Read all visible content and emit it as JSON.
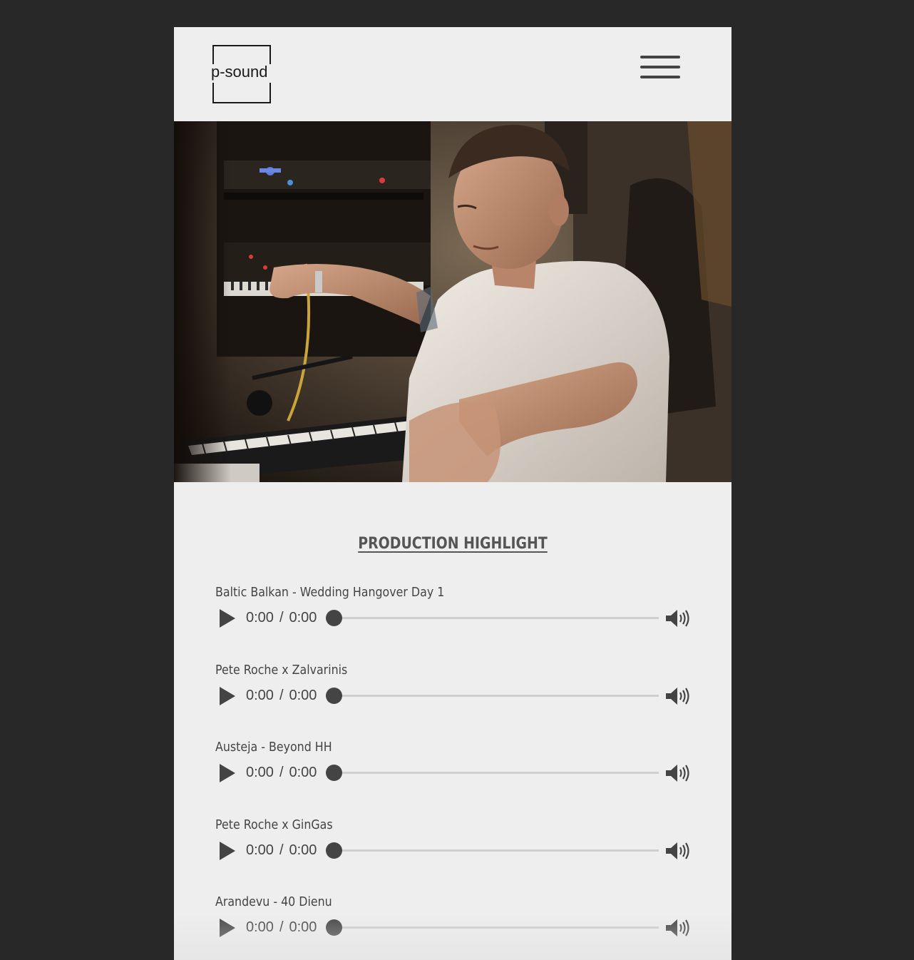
{
  "header": {
    "logo_text": "p-sound"
  },
  "hero": {
    "image": "studio-producer-photo"
  },
  "section": {
    "title": "PRODUCTION HIGHLIGHT"
  },
  "tracks": [
    {
      "title": "Baltic Balkan - Wedding Hangover Day 1",
      "current": "0:00",
      "separator": "/",
      "duration": "0:00",
      "progress": 0
    },
    {
      "title": "Pete Roche x Zalvarinis",
      "current": "0:00",
      "separator": "/",
      "duration": "0:00",
      "progress": 0
    },
    {
      "title": "Austeja - Beyond HH",
      "current": "0:00",
      "separator": "/",
      "duration": "0:00",
      "progress": 0
    },
    {
      "title": "Pete Roche x GinGas",
      "current": "0:00",
      "separator": "/",
      "duration": "0:00",
      "progress": 0
    },
    {
      "title": "Arandevu - 40 Dienu",
      "current": "0:00",
      "separator": "/",
      "duration": "0:00",
      "progress": 0
    }
  ],
  "icons": {
    "menu": "hamburger-menu-icon",
    "play": "play-icon",
    "volume": "volume-icon"
  },
  "colors": {
    "background": "#282828",
    "page": "#eeeeee",
    "text": "#444444",
    "track_bar": "#cfcfcf"
  }
}
